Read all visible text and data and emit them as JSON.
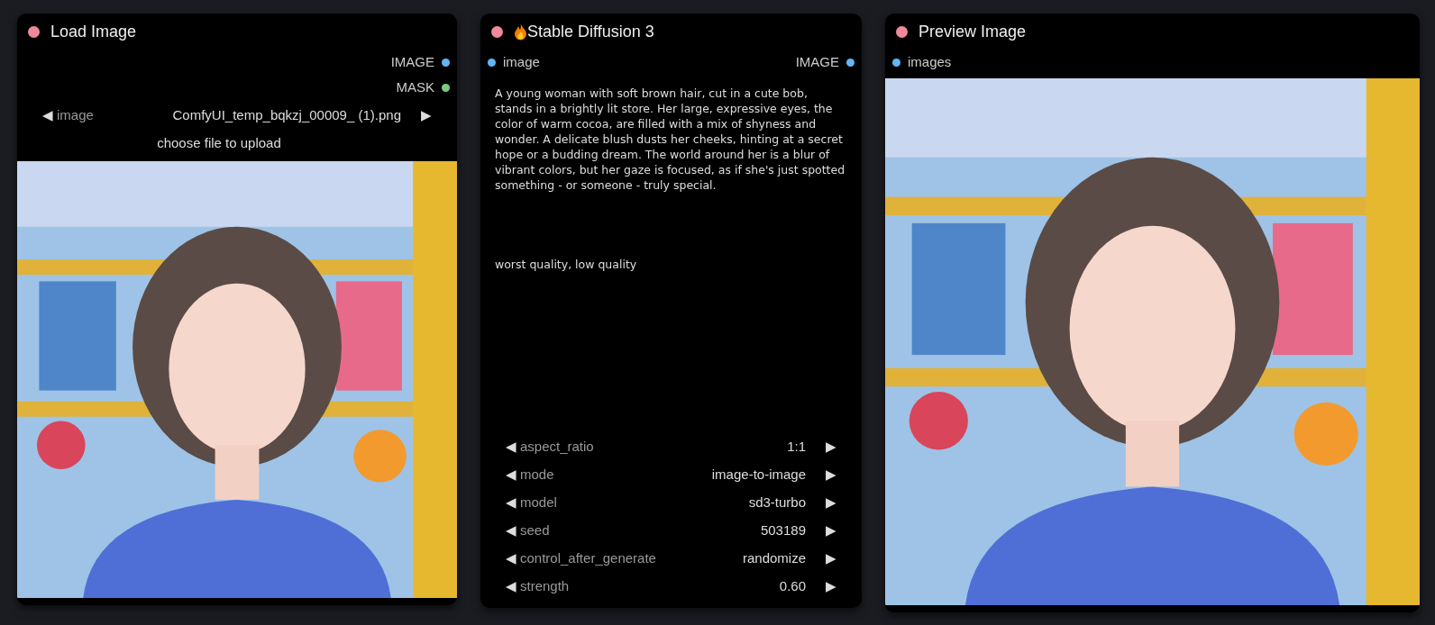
{
  "nodes": [
    {
      "title": "Load Image",
      "color": "#f08a9a",
      "outputs": [
        {
          "label": "IMAGE",
          "color": "#64b5f6"
        },
        {
          "label": "MASK",
          "color": "#81c784"
        }
      ],
      "widgets": [
        {
          "kind": "combo",
          "prev": "◀",
          "label": "image",
          "value": "ComfyUI_temp_bqkzj_00009_ (1).png",
          "next": "▶"
        },
        {
          "kind": "button",
          "label": "choose file to upload"
        }
      ],
      "image": {
        "kind": "picture"
      }
    },
    {
      "title": "Stable Diffusion 3",
      "flame": true,
      "color": "#f08a9a",
      "inputs": [
        {
          "label": "image",
          "color": "#64b5f6"
        }
      ],
      "outputs": [
        {
          "label": "IMAGE",
          "color": "#64b5f6"
        }
      ],
      "texts": [
        {
          "value": "A young woman with soft brown hair, cut in a cute bob, stands in a brightly lit store. Her large, expressive eyes, the color of warm cocoa, are filled with a mix of shyness and wonder. A delicate blush dusts her cheeks, hinting at a secret hope or a budding dream. The world around her is a blur of vibrant colors, but her gaze is focused, as if she's just spotted something - or someone - truly special."
        },
        {
          "value": "worst quality, low quality"
        }
      ],
      "widgets": [
        {
          "kind": "combo",
          "prev": "◀",
          "label": "aspect_ratio",
          "value": "1:1",
          "next": "▶"
        },
        {
          "kind": "combo",
          "prev": "◀",
          "label": "mode",
          "value": "image-to-image",
          "next": "▶"
        },
        {
          "kind": "combo",
          "prev": "◀",
          "label": "model",
          "value": "sd3-turbo",
          "next": "▶"
        },
        {
          "kind": "combo",
          "prev": "◀",
          "label": "seed",
          "value": "503189",
          "next": "▶"
        },
        {
          "kind": "combo",
          "prev": "◀",
          "label": "control_after_generate",
          "value": "randomize",
          "next": "▶"
        },
        {
          "kind": "combo",
          "prev": "◀",
          "label": "strength",
          "value": "0.60",
          "next": "▶"
        }
      ]
    },
    {
      "title": "Preview Image",
      "color": "#f08a9a",
      "inputs": [
        {
          "label": "images",
          "color": "#64b5f6"
        }
      ],
      "image": {
        "kind": "picture"
      }
    }
  ]
}
